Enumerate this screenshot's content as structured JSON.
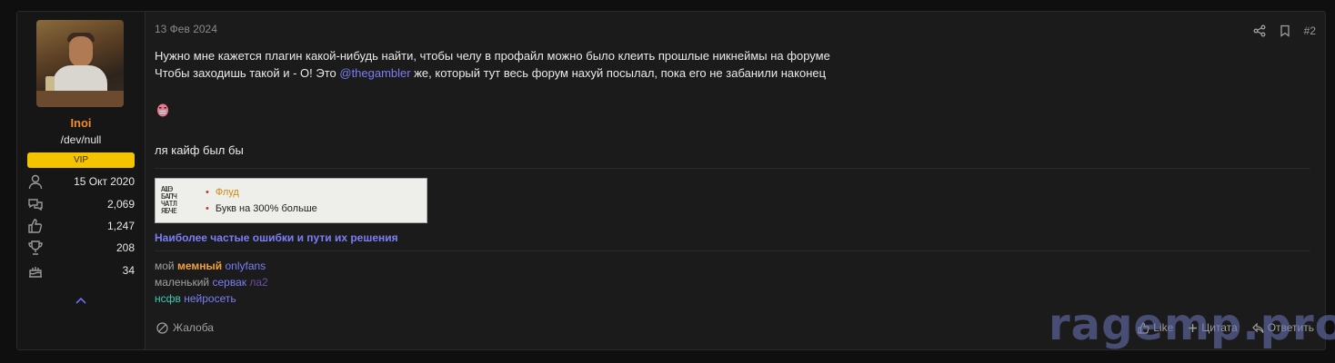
{
  "author": {
    "name": "Inoi",
    "title": "/dev/null",
    "badge": "VIP",
    "stats": [
      {
        "icon": "user-icon",
        "value": "15 Окт 2020"
      },
      {
        "icon": "messages-icon",
        "value": "2,069"
      },
      {
        "icon": "thumbs-up-icon",
        "value": "1,247"
      },
      {
        "icon": "trophy-icon",
        "value": "208"
      },
      {
        "icon": "birthday-cake-icon",
        "value": "34"
      }
    ]
  },
  "post": {
    "date": "13 Фев 2024",
    "number": "#2",
    "line1": "Нужно мне кажется плагин какой-нибудь найти, чтобы челу в профайл можно было клеить прошлые никнеймы на форуме",
    "line2_before": "Чтобы заходишь такой и - О! Это ",
    "mention": "@thegambler",
    "line2_after": " же, который тут весь форум нахуй посылал, пока его не забанили наконец",
    "line3": "ля кайф был бы"
  },
  "signature": {
    "userbar": {
      "glyph_text": "АШЭ\nБАПЧ\nЧАТЛ\nЯБЧЕ",
      "title": "Флуд",
      "subtitle": "Букв на 300% больше"
    },
    "link": "Наиболее частые ошибки и пути их решения",
    "line1": {
      "a": "мой",
      "b": "мемный",
      "c": "onlyfans"
    },
    "line2": {
      "a": "маленький",
      "b": "сервак",
      "c": "ла2"
    },
    "line3": {
      "a": "нсфв",
      "b": "нейросеть"
    }
  },
  "actions": {
    "report": "Жалоба",
    "like": "Like",
    "quote": "Цитата",
    "reply": "Ответить"
  },
  "watermark": "ragemp.pro",
  "colors": {
    "username": "#f28c28",
    "badge": "#f5c400",
    "link": "#7b7ef5",
    "background": "#1b1b1b"
  }
}
